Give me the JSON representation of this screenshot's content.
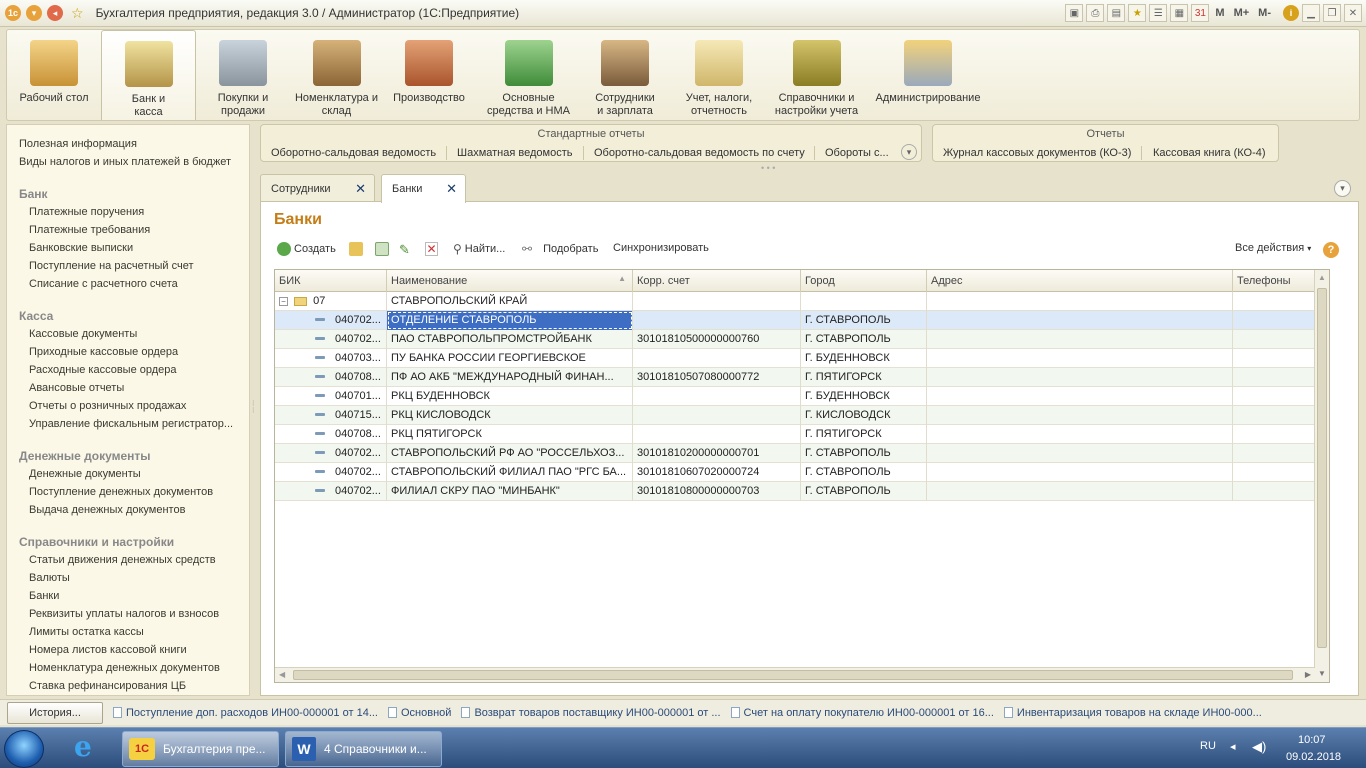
{
  "window": {
    "title": "Бухгалтерия предприятия, редакция 3.0 / Администратор  (1С:Предприятие)",
    "right_labels": [
      "M",
      "M+",
      "M-"
    ]
  },
  "sections": [
    {
      "label": "Рабочий стол",
      "icon": "desk-icon"
    },
    {
      "label": "Банк и касса",
      "icon": "bank-icon",
      "active": true
    },
    {
      "label": "Покупки и продажи",
      "icon": "truck-icon"
    },
    {
      "label": "Номенклатура и склад",
      "icon": "warehouse-icon"
    },
    {
      "label": "Производство",
      "icon": "toolbox-icon"
    },
    {
      "label": "Основные средства и НМА",
      "icon": "assets-icon"
    },
    {
      "label": "Сотрудники и зарплата",
      "icon": "employee-icon"
    },
    {
      "label": "Учет, налоги, отчетность",
      "icon": "documents-icon"
    },
    {
      "label": "Справочники и настройки учета",
      "icon": "binders-icon"
    },
    {
      "label": "Администрирование",
      "icon": "admin-icon"
    }
  ],
  "left_panel": {
    "top_links": [
      "Полезная информация",
      "Виды налогов и иных платежей в бюджет"
    ],
    "groups": [
      {
        "title": "Банк",
        "items": [
          "Платежные поручения",
          "Платежные требования",
          "Банковские выписки",
          "Поступление на расчетный счет",
          "Списание с расчетного счета"
        ]
      },
      {
        "title": "Касса",
        "items": [
          "Кассовые документы",
          "Приходные кассовые ордера",
          "Расходные кассовые ордера",
          "Авансовые отчеты",
          "Отчеты о розничных продажах",
          "Управление фискальным регистратор..."
        ]
      },
      {
        "title": "Денежные документы",
        "items": [
          "Денежные документы",
          "Поступление денежных документов",
          "Выдача денежных документов"
        ]
      },
      {
        "title": "Справочники и настройки",
        "items": [
          "Статьи движения денежных средств",
          "Валюты",
          "Банки",
          "Реквизиты уплаты налогов и взносов",
          "Лимиты остатка кассы",
          "Номера листов кассовой книги",
          "Номенклатура денежных документов",
          "Ставка рефинансирования ЦБ"
        ]
      }
    ]
  },
  "reports_standard": {
    "title": "Стандартные отчеты",
    "items": [
      "Оборотно-сальдовая ведомость",
      "Шахматная ведомость",
      "Оборотно-сальдовая ведомость по счету",
      "Обороты с..."
    ]
  },
  "reports": {
    "title": "Отчеты",
    "items": [
      "Журнал кассовых документов (КО-3)",
      "Кассовая книга (КО-4)"
    ]
  },
  "tabs": [
    {
      "label": "Сотрудники"
    },
    {
      "label": "Банки",
      "active": true
    }
  ],
  "form": {
    "title": "Банки",
    "toolbar": {
      "create": "Создать",
      "find": "Найти...",
      "pick": "Подобрать",
      "sync": "Синхронизировать",
      "all_actions": "Все действия"
    },
    "columns": [
      "БИК",
      "Наименование",
      "Корр. счет",
      "Город",
      "Адрес",
      "Телефоны"
    ],
    "group_row": {
      "code": "07",
      "name": "СТАВРОПОЛЬСКИЙ КРАЙ"
    },
    "rows": [
      {
        "bik": "040702...",
        "name": "ОТДЕЛЕНИЕ СТАВРОПОЛЬ",
        "corr": "",
        "city": "Г. СТАВРОПОЛЬ"
      },
      {
        "bik": "040702...",
        "name": "ПАО СТАВРОПОЛЬПРОМСТРОЙБАНК",
        "corr": "30101810500000000760",
        "city": "Г. СТАВРОПОЛЬ"
      },
      {
        "bik": "040703...",
        "name": "ПУ БАНКА РОССИИ ГЕОРГИЕВСКОЕ",
        "corr": "",
        "city": "Г. БУДЕННОВСК"
      },
      {
        "bik": "040708...",
        "name": "ПФ АО АКБ \"МЕЖДУНАРОДНЫЙ ФИНАН...",
        "corr": "30101810507080000772",
        "city": "Г. ПЯТИГОРСК"
      },
      {
        "bik": "040701...",
        "name": "РКЦ БУДЕННОВСК",
        "corr": "",
        "city": "Г. БУДЕННОВСК"
      },
      {
        "bik": "040715...",
        "name": "РКЦ КИСЛОВОДСК",
        "corr": "",
        "city": "Г. КИСЛОВОДСК"
      },
      {
        "bik": "040708...",
        "name": "РКЦ ПЯТИГОРСК",
        "corr": "",
        "city": "Г. ПЯТИГОРСК"
      },
      {
        "bik": "040702...",
        "name": "СТАВРОПОЛЬСКИЙ РФ АО \"РОССЕЛЬХОЗ...",
        "corr": "30101810200000000701",
        "city": "Г. СТАВРОПОЛЬ"
      },
      {
        "bik": "040702...",
        "name": "СТАВРОПОЛЬСКИЙ ФИЛИАЛ ПАО \"РГС БА...",
        "corr": "30101810607020000724",
        "city": "Г. СТАВРОПОЛЬ"
      },
      {
        "bik": "040702...",
        "name": "ФИЛИАЛ СКРУ ПАО \"МИНБАНК\"",
        "corr": "30101810800000000703",
        "city": "Г. СТАВРОПОЛЬ"
      }
    ]
  },
  "history": {
    "button": "История...",
    "items": [
      "Поступление доп. расходов ИН00-000001 от 14...",
      "Основной",
      "Возврат товаров поставщику ИН00-000001 от ...",
      "Счет на оплату покупателю ИН00-000001 от 16...",
      "Инвентаризация товаров на складе ИН00-000..."
    ]
  },
  "taskbar": {
    "tasks": [
      "Бухгалтерия пре...",
      "4 Справочники и..."
    ],
    "lang": "RU",
    "time": "10:07",
    "date": "09.02.2018"
  }
}
